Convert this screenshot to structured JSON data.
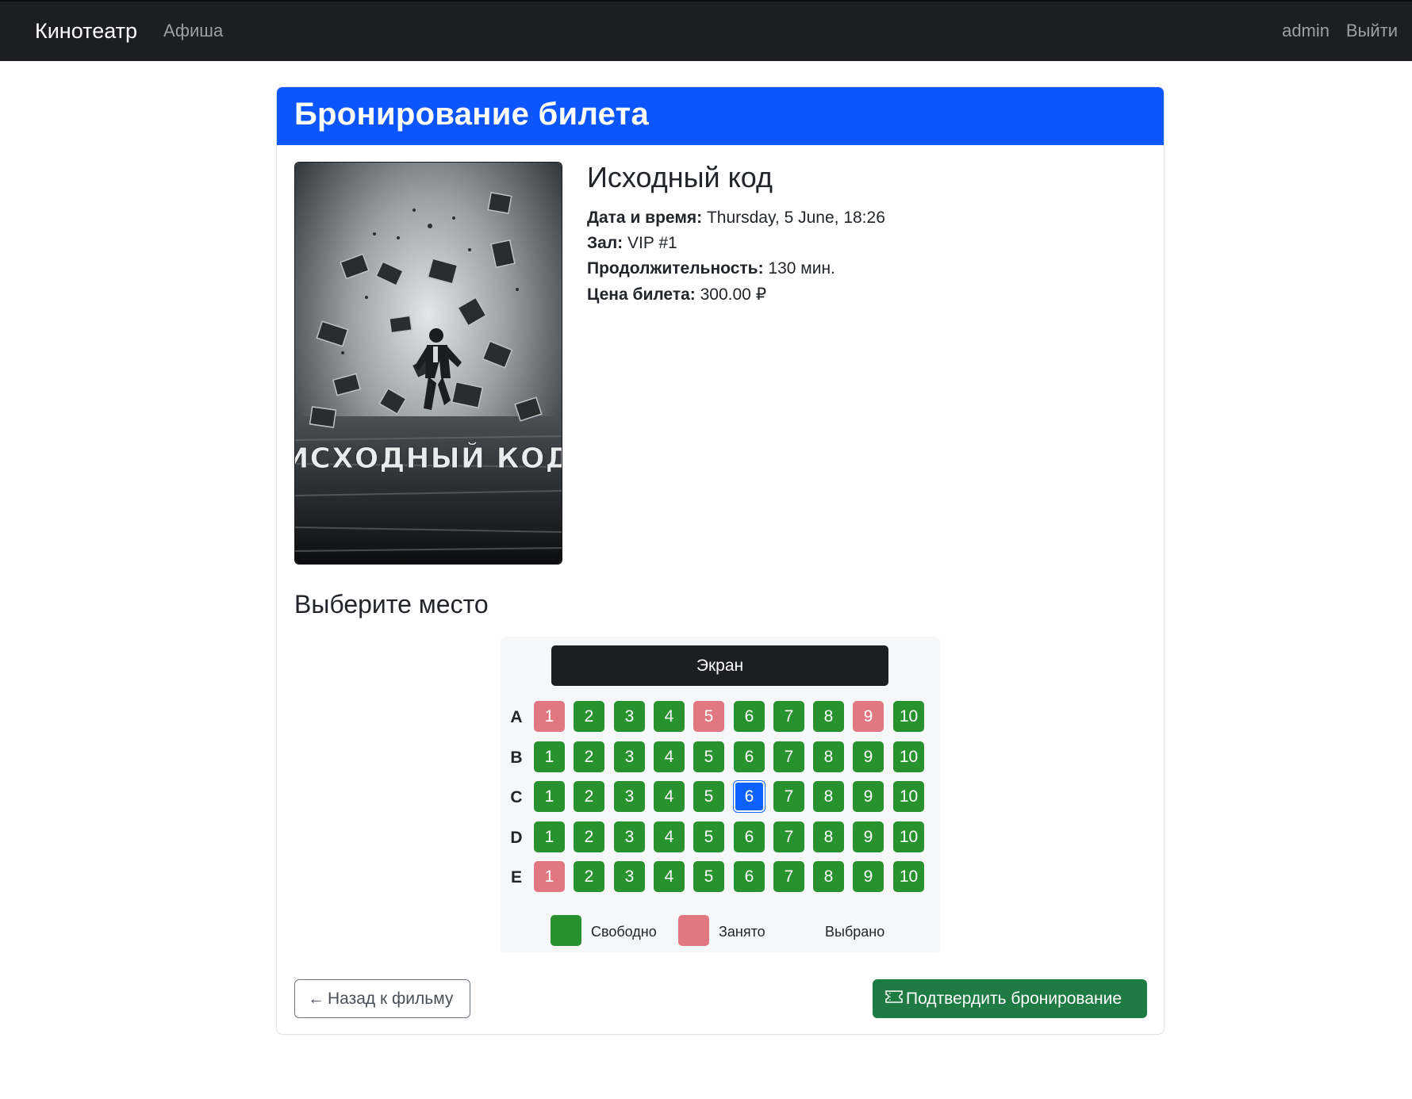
{
  "nav": {
    "brand": "Кинотеатр",
    "afisha": "Афиша",
    "user": "admin",
    "logout": "Выйти"
  },
  "page": {
    "title": "Бронирование билета"
  },
  "movie": {
    "title": "Исходный код",
    "poster_text": "ИСХОДНЫЙ КОД",
    "datetime_label": "Дата и время:",
    "datetime_value": "Thursday, 5 June, 18:26",
    "hall_label": "Зал:",
    "hall_value": "VIP #1",
    "duration_label": "Продолжительность:",
    "duration_value": "130 мин.",
    "price_label": "Цена билета:",
    "price_value": "300.00 ₽"
  },
  "seating": {
    "heading": "Выберите место",
    "screen_label": "Экран",
    "rows": [
      {
        "label": "A",
        "seats": [
          {
            "n": "1",
            "status": "taken"
          },
          {
            "n": "2",
            "status": "free"
          },
          {
            "n": "3",
            "status": "free"
          },
          {
            "n": "4",
            "status": "free"
          },
          {
            "n": "5",
            "status": "taken"
          },
          {
            "n": "6",
            "status": "free"
          },
          {
            "n": "7",
            "status": "free"
          },
          {
            "n": "8",
            "status": "free"
          },
          {
            "n": "9",
            "status": "taken"
          },
          {
            "n": "10",
            "status": "free"
          }
        ]
      },
      {
        "label": "B",
        "seats": [
          {
            "n": "1",
            "status": "free"
          },
          {
            "n": "2",
            "status": "free"
          },
          {
            "n": "3",
            "status": "free"
          },
          {
            "n": "4",
            "status": "free"
          },
          {
            "n": "5",
            "status": "free"
          },
          {
            "n": "6",
            "status": "free"
          },
          {
            "n": "7",
            "status": "free"
          },
          {
            "n": "8",
            "status": "free"
          },
          {
            "n": "9",
            "status": "free"
          },
          {
            "n": "10",
            "status": "free"
          }
        ]
      },
      {
        "label": "C",
        "seats": [
          {
            "n": "1",
            "status": "free"
          },
          {
            "n": "2",
            "status": "free"
          },
          {
            "n": "3",
            "status": "free"
          },
          {
            "n": "4",
            "status": "free"
          },
          {
            "n": "5",
            "status": "free"
          },
          {
            "n": "6",
            "status": "selected"
          },
          {
            "n": "7",
            "status": "free"
          },
          {
            "n": "8",
            "status": "free"
          },
          {
            "n": "9",
            "status": "free"
          },
          {
            "n": "10",
            "status": "free"
          }
        ]
      },
      {
        "label": "D",
        "seats": [
          {
            "n": "1",
            "status": "free"
          },
          {
            "n": "2",
            "status": "free"
          },
          {
            "n": "3",
            "status": "free"
          },
          {
            "n": "4",
            "status": "free"
          },
          {
            "n": "5",
            "status": "free"
          },
          {
            "n": "6",
            "status": "free"
          },
          {
            "n": "7",
            "status": "free"
          },
          {
            "n": "8",
            "status": "free"
          },
          {
            "n": "9",
            "status": "free"
          },
          {
            "n": "10",
            "status": "free"
          }
        ]
      },
      {
        "label": "E",
        "seats": [
          {
            "n": "1",
            "status": "taken"
          },
          {
            "n": "2",
            "status": "free"
          },
          {
            "n": "3",
            "status": "free"
          },
          {
            "n": "4",
            "status": "free"
          },
          {
            "n": "5",
            "status": "free"
          },
          {
            "n": "6",
            "status": "free"
          },
          {
            "n": "7",
            "status": "free"
          },
          {
            "n": "8",
            "status": "free"
          },
          {
            "n": "9",
            "status": "free"
          },
          {
            "n": "10",
            "status": "free"
          }
        ]
      }
    ],
    "legend": {
      "free": "Свободно",
      "taken": "Занято",
      "selected": "Выбрано"
    }
  },
  "actions": {
    "back_label": "Назад к фильму",
    "confirm_label": "Подтвердить бронирование"
  },
  "colors": {
    "header_blue": "#0d56fd",
    "seat_free": "#27922e",
    "seat_taken": "#e07781",
    "seat_selected": "#0d62fd",
    "confirm_button": "#1f7a44",
    "navbar": "#1c1e21"
  }
}
